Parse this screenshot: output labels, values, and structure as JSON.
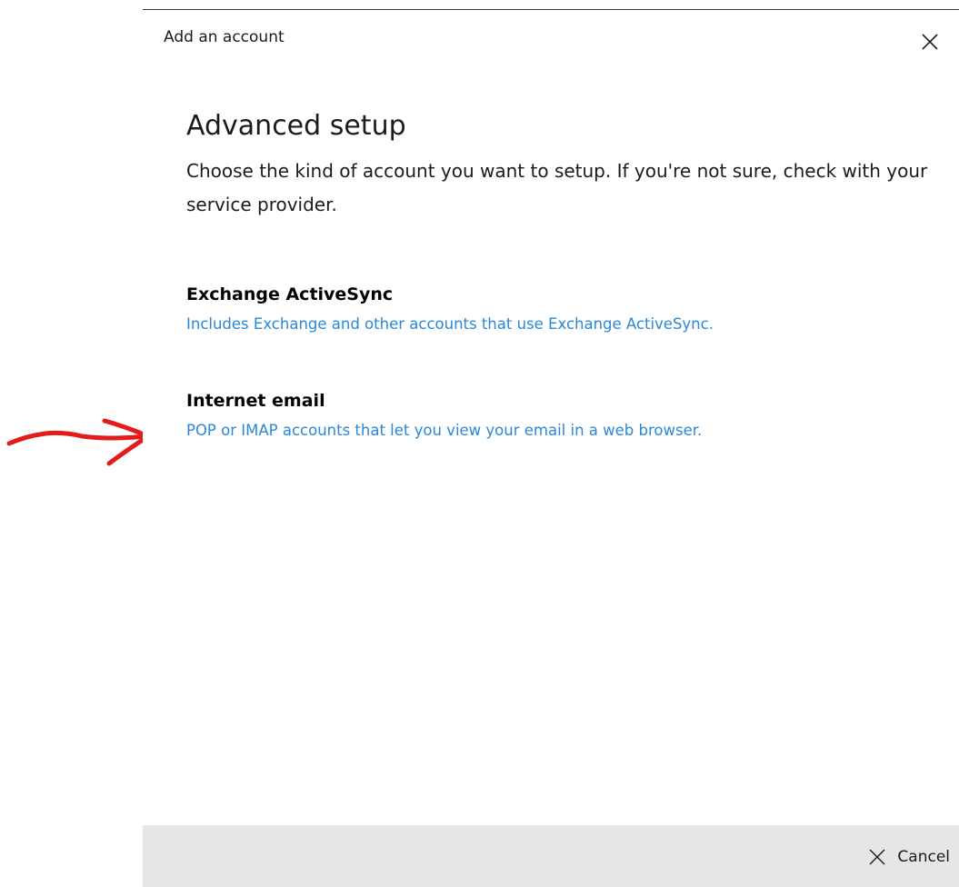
{
  "dialog": {
    "window_title": "Add an account",
    "close_icon": "close-icon",
    "heading": "Advanced setup",
    "subtitle": "Choose the kind of account you want to setup. If you're not sure, check with your service provider."
  },
  "options": [
    {
      "title": "Exchange ActiveSync",
      "description": "Includes Exchange and other accounts that use Exchange ActiveSync."
    },
    {
      "title": "Internet email",
      "description": "POP or IMAP accounts that let you view your email in a web browser."
    }
  ],
  "footer": {
    "cancel_label": "Cancel",
    "cancel_icon": "close-icon"
  },
  "annotation": {
    "arrow_icon": "arrow-right-icon",
    "color": "#e31b1b"
  },
  "colors": {
    "link": "#2b88d8",
    "footer_bg": "#e6e6e6",
    "text": "#1b1b1b"
  }
}
